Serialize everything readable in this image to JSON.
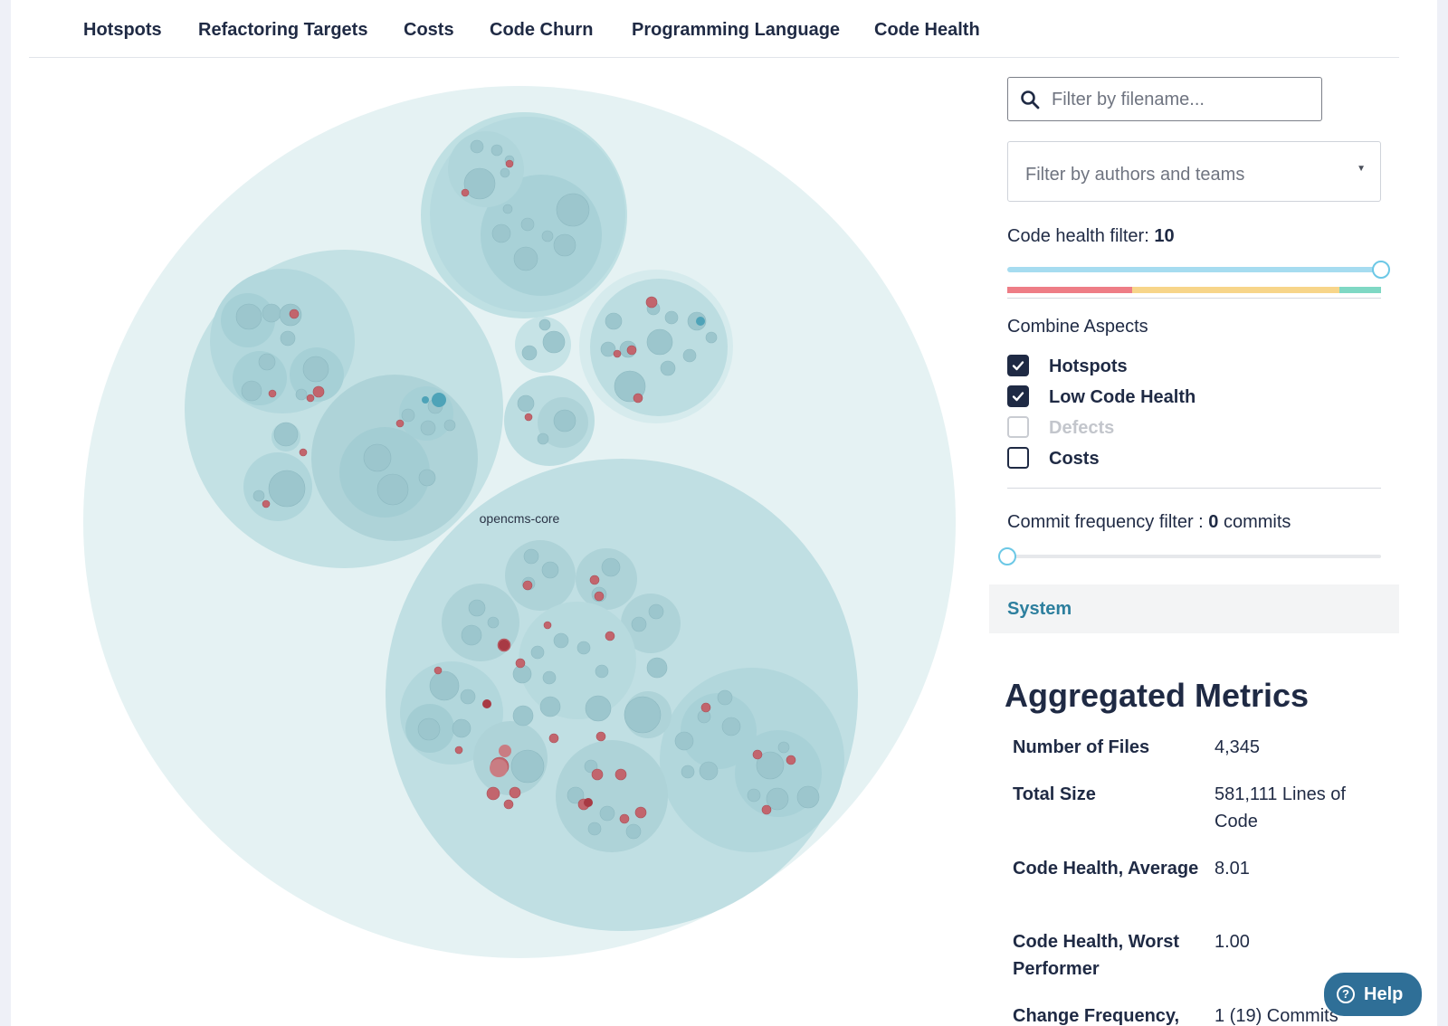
{
  "tabs": [
    {
      "label": "Hotspots",
      "active": true
    },
    {
      "label": "Refactoring Targets"
    },
    {
      "label": "Costs"
    },
    {
      "label": "Code Churn"
    },
    {
      "label": "Programming Language"
    },
    {
      "label": "Code Health"
    }
  ],
  "viz": {
    "root_label": "opencms-core"
  },
  "filters": {
    "filename_placeholder": "Filter by filename...",
    "authors_placeholder": "Filter by authors and teams",
    "code_health_label": "Code health filter: ",
    "code_health_value": "10",
    "commit_label": "Commit frequency filter : ",
    "commit_value": "0",
    "commit_unit": " commits"
  },
  "combine": {
    "title": "Combine Aspects",
    "items": [
      {
        "label": "Hotspots",
        "checked": true,
        "disabled": false
      },
      {
        "label": "Low Code Health",
        "checked": true,
        "disabled": false
      },
      {
        "label": "Defects",
        "checked": false,
        "disabled": true
      },
      {
        "label": "Costs",
        "checked": false,
        "disabled": false
      }
    ]
  },
  "system": {
    "label": "System"
  },
  "metrics": {
    "title": "Aggregated Metrics",
    "rows": [
      {
        "label": "Number of Files",
        "value": "4,345"
      },
      {
        "label": "Total Size",
        "value": "581,111 Lines of Code"
      },
      {
        "label": "Code Health, Average",
        "value": "8.01"
      },
      {
        "label": "Code Health, Worst Performer",
        "value": "1.00"
      },
      {
        "label": "Change Frequency,",
        "value": "1 (19) Commits"
      }
    ]
  },
  "help": {
    "label": "Help"
  },
  "colors": {
    "accent": "#2d7f9e",
    "health_red": "#ee7d86",
    "health_yellow": "#f7d58a",
    "health_green": "#7fd8c4",
    "slider_fill": "#a6dcf0"
  }
}
